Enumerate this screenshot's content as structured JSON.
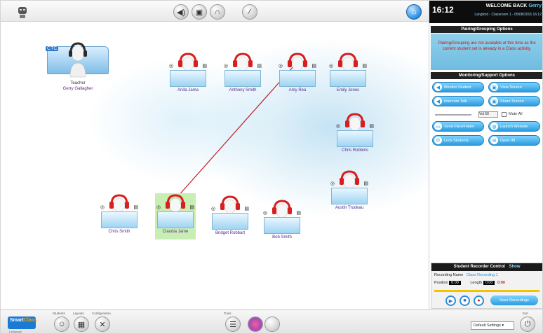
{
  "clock": "16:12",
  "welcome": {
    "prefix": "WELCOME BACK",
    "user": "Gerry",
    "sub": "Langford - Classroom 1 - 05/08/2016 16:12"
  },
  "panels": {
    "pairing_title": "Pairing/Grouping Options",
    "pairing_message": "Pairing/Grouping are not available at this time as the current student set is already in a Class activity.",
    "monitoring_title": "Monitoring/Support Options"
  },
  "monitoring_buttons": [
    {
      "label": "Monitor Student",
      "icon": "speaker-icon"
    },
    {
      "label": "View Screen",
      "icon": "monitor-icon"
    },
    {
      "label": "Intercom Talk",
      "icon": "speaker-icon"
    },
    {
      "label": "Share Screen",
      "icon": "monitor-icon"
    },
    {
      "label": "Send Files/Folder",
      "icon": "folder-icon"
    },
    {
      "label": "Launch Website",
      "icon": "globe-icon"
    },
    {
      "label": "Lock Students",
      "icon": "lock-icon"
    },
    {
      "label": "Open IM",
      "icon": "chat-icon"
    }
  ],
  "volume": {
    "select_value": "Vol 50",
    "mute_label": "Mute All"
  },
  "recorder": {
    "title": "Student Recorder Control",
    "toggle_label": "Show",
    "recording_name_label": "Recording Name",
    "recording_name_value": "Class Recording 1",
    "position_label": "Position",
    "position_value": "0:00",
    "length_label": "Length",
    "length_value": "0:00",
    "length_status": "0:00",
    "save_label": "Save Recordings"
  },
  "teacher": {
    "label": "Teacher",
    "name": "Gerry Gallagher",
    "brand": "CTC"
  },
  "students": [
    {
      "name": "Anita Jama"
    },
    {
      "name": "Anthony Smith"
    },
    {
      "name": "Amy Rea"
    },
    {
      "name": "Emily Jones"
    },
    {
      "name": "Chris Robbins"
    },
    {
      "name": "Austin Trudeau"
    },
    {
      "name": "Chris Smith"
    },
    {
      "name": "Claudia Jame"
    },
    {
      "name": "Bridget Robbart"
    },
    {
      "name": "Bob Smith"
    }
  ],
  "bottom": {
    "logo_main": "Smart",
    "logo_accent": "Class",
    "logo_sub": "Language",
    "labels": [
      "Students",
      "Layouts",
      "Configuration"
    ],
    "tools_label": "Tools",
    "group_select": "Default Settings",
    "exit_label": "Exit"
  },
  "colors": {
    "accent": "#2b9ce0",
    "selected": "#c8eeb4",
    "headset": "#d62020",
    "line": "#c0202a"
  }
}
